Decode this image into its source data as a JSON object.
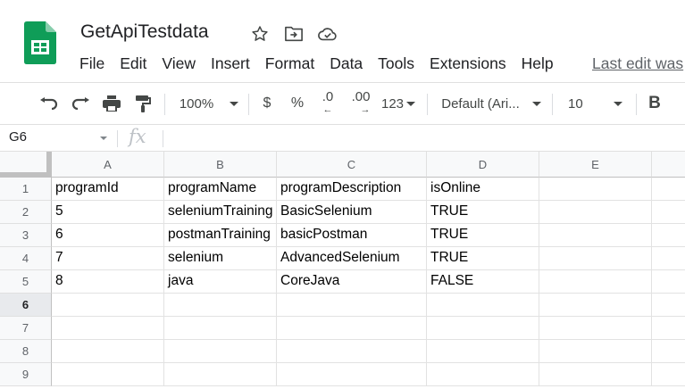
{
  "app": {
    "doc_title": "GetApiTestdata",
    "menu": [
      "File",
      "Edit",
      "View",
      "Insert",
      "Format",
      "Data",
      "Tools",
      "Extensions",
      "Help"
    ],
    "last_edit": "Last edit was"
  },
  "toolbar": {
    "zoom": "100%",
    "currency": "$",
    "percent": "%",
    "dec_decrease": ".0",
    "dec_increase": ".00",
    "number_format": "123",
    "font": "Default (Ari...",
    "font_size": "10",
    "bold": "B"
  },
  "formula_bar": {
    "name_box": "G6",
    "fx": "fx",
    "formula": ""
  },
  "sheet": {
    "columns": [
      "A",
      "B",
      "C",
      "D",
      "E"
    ],
    "rows": [
      "1",
      "2",
      "3",
      "4",
      "5",
      "6",
      "7",
      "8",
      "9"
    ],
    "selected_row": "6",
    "cells": [
      [
        "programId",
        "programName",
        "programDescription",
        "isOnline",
        ""
      ],
      [
        "5",
        "seleniumTraining",
        "BasicSelenium",
        "TRUE",
        ""
      ],
      [
        "6",
        "postmanTraining",
        "basicPostman",
        "TRUE",
        ""
      ],
      [
        "7",
        "selenium",
        "AdvancedSelenium",
        "TRUE",
        ""
      ],
      [
        "8",
        "java",
        "CoreJava",
        "FALSE",
        ""
      ],
      [
        "",
        "",
        "",
        "",
        ""
      ],
      [
        "",
        "",
        "",
        "",
        ""
      ],
      [
        "",
        "",
        "",
        "",
        ""
      ],
      [
        "",
        "",
        "",
        "",
        ""
      ]
    ]
  },
  "colors": {
    "sheets_green": "#0f9d58",
    "header_bg": "#f8f9fa",
    "grid_line": "#e2e2e2",
    "icon_gray": "#444746"
  }
}
